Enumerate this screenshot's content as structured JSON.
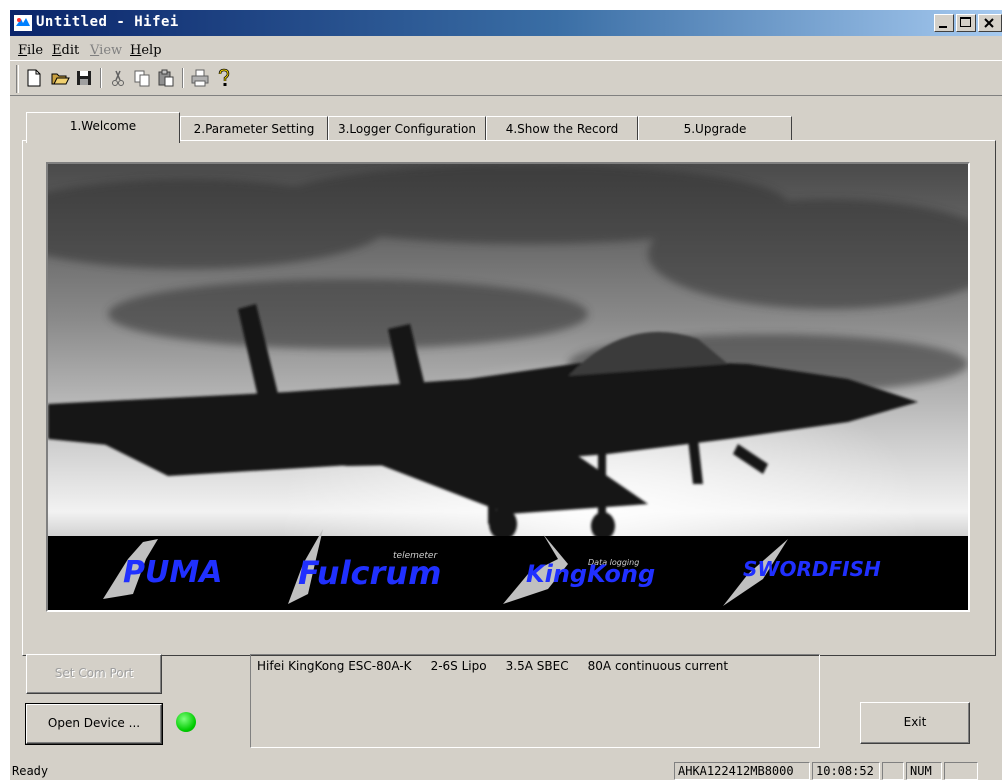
{
  "window": {
    "title": "Untitled - Hifei"
  },
  "menu": [
    {
      "label": "File",
      "enabled": true
    },
    {
      "label": "Edit",
      "enabled": true
    },
    {
      "label": "View",
      "enabled": false
    },
    {
      "label": "Help",
      "enabled": true
    }
  ],
  "toolbar": {
    "icons": [
      "new-file-icon",
      "open-folder-icon",
      "save-icon",
      "cut-icon",
      "copy-icon",
      "paste-icon",
      "print-icon",
      "help-icon"
    ]
  },
  "tabs": [
    {
      "label": "1.Welcome",
      "active": true
    },
    {
      "label": "2.Parameter Setting",
      "active": false
    },
    {
      "label": "3.Logger Configuration",
      "active": false
    },
    {
      "label": "4.Show the Record",
      "active": false
    },
    {
      "label": "5.Upgrade",
      "active": false
    }
  ],
  "banner": {
    "brands": [
      {
        "name": "PUMA",
        "tag": ""
      },
      {
        "name": "Fulcrum",
        "tag": "telemeter"
      },
      {
        "name": "KingKong",
        "tag": "Data logging"
      },
      {
        "name": "SWORDFISH",
        "tag": ""
      }
    ]
  },
  "buttons": {
    "set_com_port": "Set Com Port",
    "open_device": "Open Device ...",
    "exit": "Exit"
  },
  "device_info": "Hifei KingKong ESC-80A-K     2-6S Lipo     3.5A SBEC     80A continuous current",
  "led": {
    "status": "connected",
    "color": "#00cc00"
  },
  "statusbar": {
    "status": "Ready",
    "serial": "AHKA122412MB8000",
    "time": "10:08:52",
    "num": "NUM"
  },
  "colors": {
    "titlebar": "#0a246a",
    "face": "#d4d0c8",
    "led": "#00cc00"
  }
}
